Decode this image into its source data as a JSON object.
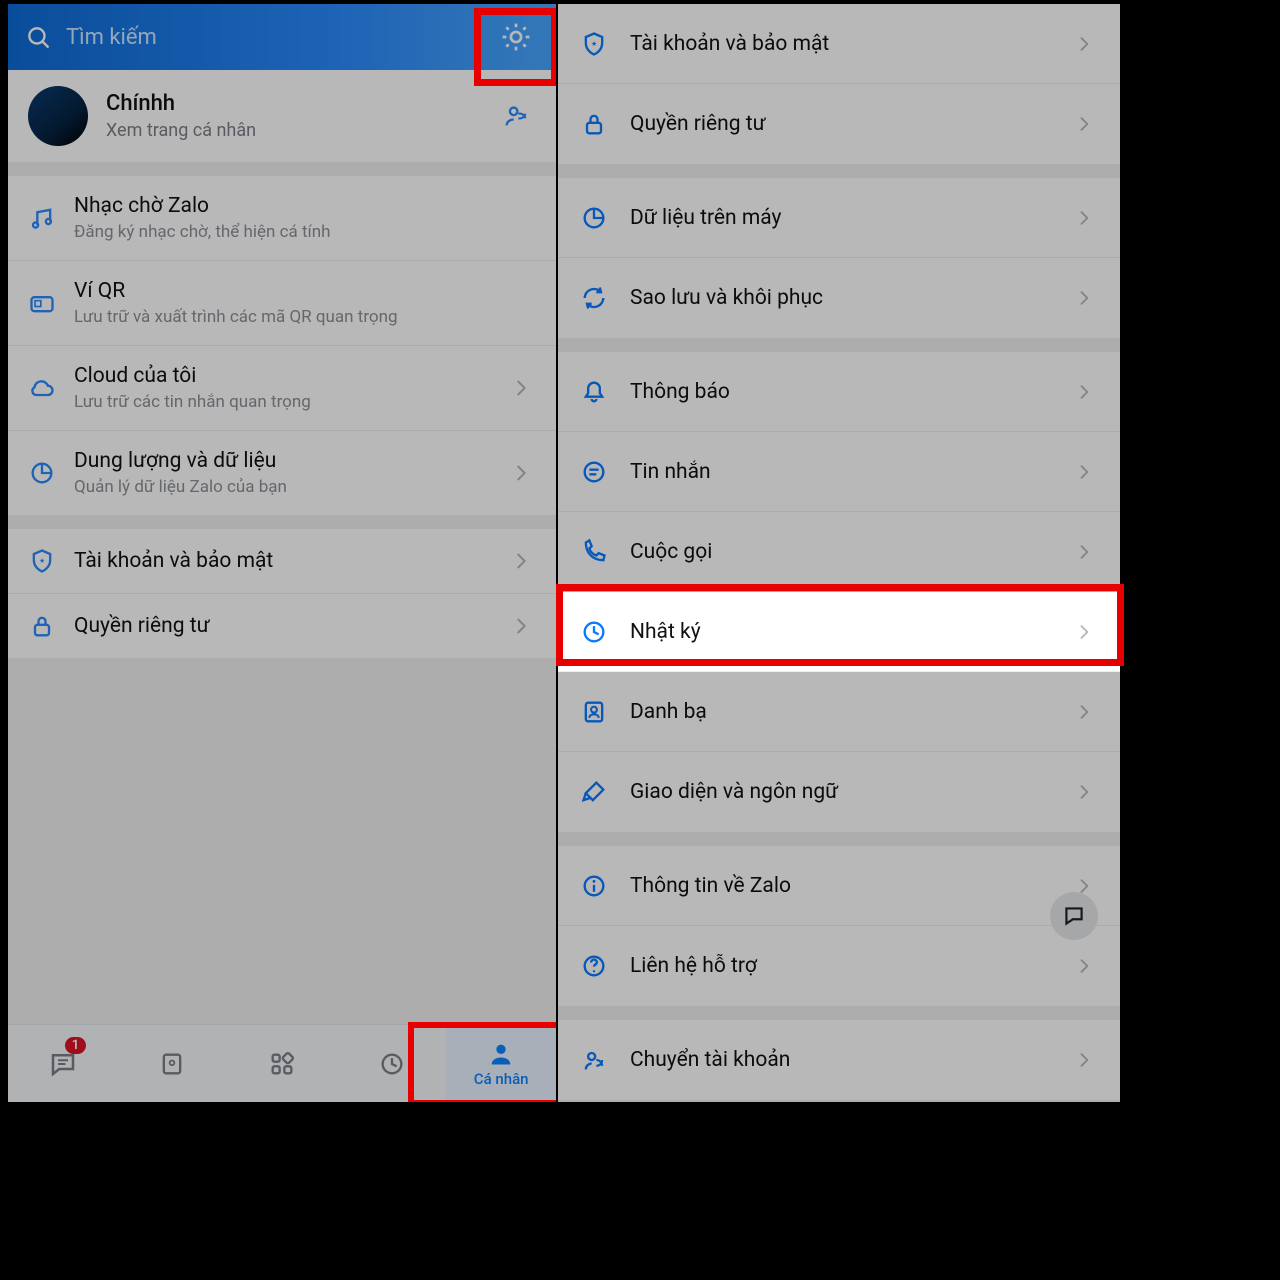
{
  "header": {
    "search_placeholder": "Tìm kiếm"
  },
  "profile": {
    "name": "Chínhh",
    "sub": "Xem trang cá nhân"
  },
  "left_menu": {
    "group1": [
      {
        "icon": "music",
        "title": "Nhạc chờ Zalo",
        "sub": "Đăng ký nhạc chờ, thể hiện cá tính",
        "show_chevron": false
      },
      {
        "icon": "wallet",
        "title": "Ví QR",
        "sub": "Lưu trữ và xuất trình các mã QR quan trọng",
        "show_chevron": false
      },
      {
        "icon": "cloud",
        "title": "Cloud của tôi",
        "sub": "Lưu trữ các tin nhắn quan trọng",
        "show_chevron": true
      },
      {
        "icon": "pie",
        "title": "Dung lượng và dữ liệu",
        "sub": "Quản lý dữ liệu Zalo của bạn",
        "show_chevron": true
      }
    ],
    "group2": [
      {
        "icon": "shield",
        "title": "Tài khoản và bảo mật",
        "sub": "",
        "show_chevron": true
      },
      {
        "icon": "lock",
        "title": "Quyền riêng tư",
        "sub": "",
        "show_chevron": true
      }
    ]
  },
  "bottom_nav": {
    "badge": "1",
    "active_label": "Cá nhân"
  },
  "settings": {
    "g1": [
      {
        "icon": "shield",
        "title": "Tài khoản và bảo mật"
      },
      {
        "icon": "lock",
        "title": "Quyền riêng tư"
      }
    ],
    "g2": [
      {
        "icon": "pie",
        "title": "Dữ liệu trên máy"
      },
      {
        "icon": "sync",
        "title": "Sao lưu và khôi phục"
      }
    ],
    "g3": [
      {
        "icon": "bell",
        "title": "Thông báo"
      },
      {
        "icon": "chat",
        "title": "Tin nhắn"
      },
      {
        "icon": "phone",
        "title": "Cuộc gọi"
      },
      {
        "icon": "clock",
        "title": "Nhật ký"
      },
      {
        "icon": "contacts",
        "title": "Danh bạ"
      },
      {
        "icon": "brush",
        "title": "Giao diện và ngôn ngữ"
      }
    ],
    "g4": [
      {
        "icon": "info",
        "title": "Thông tin về Zalo"
      },
      {
        "icon": "help",
        "title": "Liên hệ hỗ trợ"
      }
    ],
    "g5": [
      {
        "icon": "switch",
        "title": "Chuyển tài khoản"
      }
    ]
  }
}
